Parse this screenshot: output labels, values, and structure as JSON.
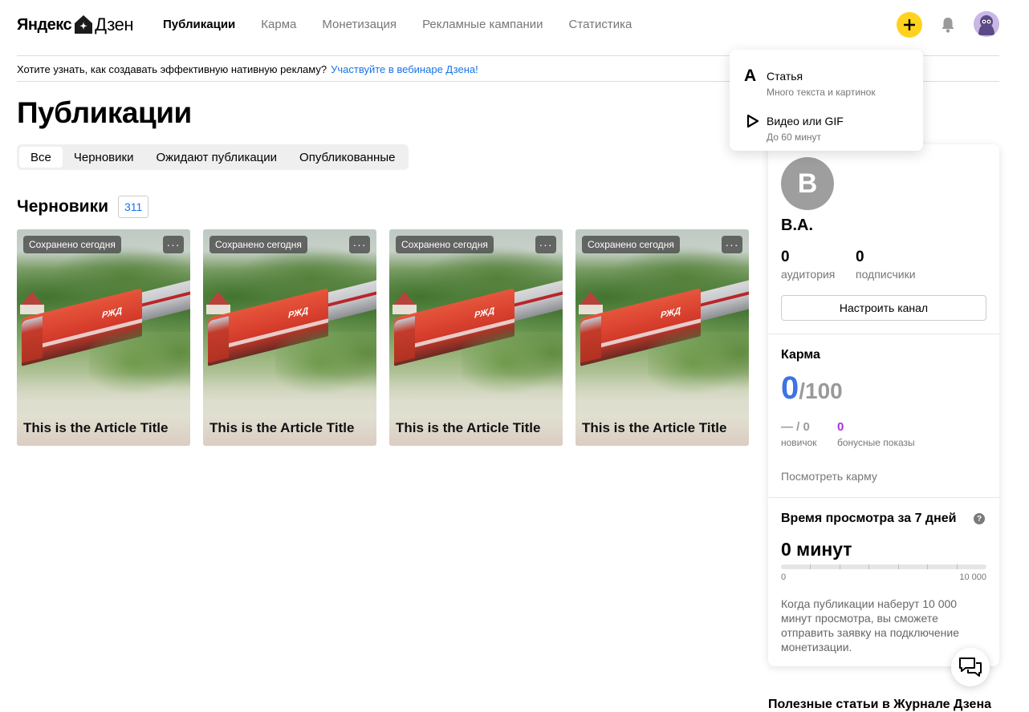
{
  "header": {
    "logo_left": "Яндекс",
    "logo_right": "Дзен",
    "nav": [
      {
        "label": "Публикации",
        "active": true
      },
      {
        "label": "Карма",
        "active": false
      },
      {
        "label": "Монетизация",
        "active": false
      },
      {
        "label": "Рекламные кампании",
        "active": false
      },
      {
        "label": "Статистика",
        "active": false
      }
    ],
    "icons": {
      "add": "plus-icon",
      "notifications": "bell-icon",
      "profile": "avatar"
    }
  },
  "banner": {
    "text": "Хотите узнать, как создавать эффективную нативную рекламу?",
    "link": "Участвуйте в вебинаре Дзена!"
  },
  "dropdown": {
    "items": [
      {
        "title": "Статья",
        "subtitle": "Много текста и картинок",
        "icon": "article-icon"
      },
      {
        "title": "Видео или GIF",
        "subtitle": "До 60 минут",
        "icon": "play-icon"
      }
    ]
  },
  "main": {
    "title": "Публикации",
    "tabs": [
      {
        "label": "Все",
        "active": true
      },
      {
        "label": "Черновики",
        "active": false
      },
      {
        "label": "Ожидают публикации",
        "active": false
      },
      {
        "label": "Опубликованные",
        "active": false
      }
    ],
    "drafts_title": "Черновики",
    "drafts_count": "311",
    "cards": [
      {
        "saved": "Сохранено сегодня",
        "more": "···",
        "title": "This is the Article Title"
      },
      {
        "saved": "Сохранено сегодня",
        "more": "···",
        "title": "This is the Article Title"
      },
      {
        "saved": "Сохранено сегодня",
        "more": "···",
        "title": "This is the Article Title"
      },
      {
        "saved": "Сохранено сегодня",
        "more": "···",
        "title": "This is the Article Title"
      }
    ]
  },
  "panel": {
    "avatar_letter": "В",
    "name": "В.А.",
    "audience": {
      "value": "0",
      "label": "аудитория"
    },
    "subscribers": {
      "value": "0",
      "label": "подписчики"
    },
    "setup_button": "Настроить канал",
    "karma": {
      "title": "Карма",
      "value": "0",
      "max": "/100",
      "newbie": {
        "value": "— / 0",
        "label": "новичок"
      },
      "bonus": {
        "value": "0",
        "label": "бонусные показы"
      },
      "link": "Посмотреть карму"
    },
    "watch": {
      "title": "Время просмотра за 7 дней",
      "help": "?",
      "value": "0 минут",
      "progress": 0,
      "min_label": "0",
      "max_label": "10 000",
      "description": "Когда публикации наберут 10 000 минут просмотра, вы сможете отправить заявку на подключение монетизации."
    }
  },
  "footer": {
    "useful_title": "Полезные статьи в Журнале Дзена"
  },
  "colors": {
    "accent_yellow": "#ffd21f",
    "link_blue": "#1a73e8",
    "karma_blue": "#3f72e4",
    "bonus_purple": "#a92ee3"
  }
}
